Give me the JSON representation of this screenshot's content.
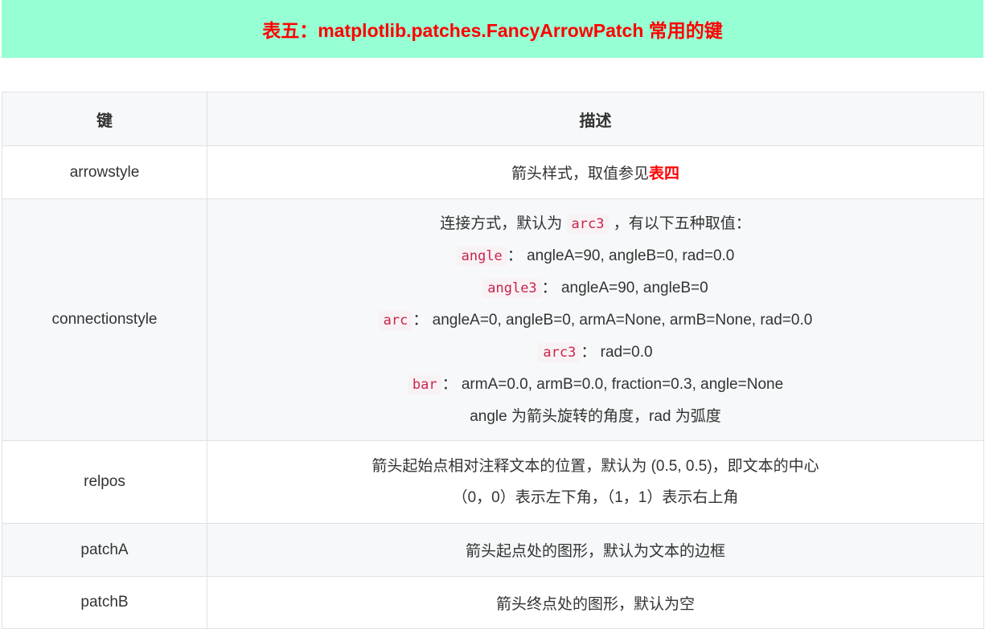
{
  "banner": {
    "title": "表五：matplotlib.patches.FancyArrowPatch 常用的键"
  },
  "table": {
    "headers": [
      "键",
      "描述"
    ],
    "rows": [
      {
        "key": "arrowstyle",
        "desc_text": "箭头样式，取值参见",
        "desc_emphasis": "表四"
      },
      {
        "key": "connectionstyle",
        "intro_before": "连接方式，默认为",
        "intro_code": "arc3",
        "intro_after": "，有以下五种取值：",
        "options": [
          {
            "code": "angle",
            "text": "：  angleA=90, angleB=0, rad=0.0"
          },
          {
            "code": "angle3",
            "text": "：  angleA=90, angleB=0"
          },
          {
            "code": "arc",
            "text": "：  angleA=0, angleB=0, armA=None, armB=None, rad=0.0"
          },
          {
            "code": "arc3",
            "text": "：  rad=0.0"
          },
          {
            "code": "bar",
            "text": "：  armA=0.0, armB=0.0, fraction=0.3, angle=None"
          }
        ],
        "note": "angle 为箭头旋转的角度，rad 为弧度"
      },
      {
        "key": "relpos",
        "line1": "箭头起始点相对注释文本的位置，默认为 (0.5, 0.5)，即文本的中心",
        "line2": "（0，0）表示左下角，（1，1）表示右上角"
      },
      {
        "key": "patchA",
        "desc": "箭头起点处的图形，默认为文本的边框"
      },
      {
        "key": "patchB",
        "desc": "箭头终点处的图形，默认为空"
      }
    ]
  }
}
